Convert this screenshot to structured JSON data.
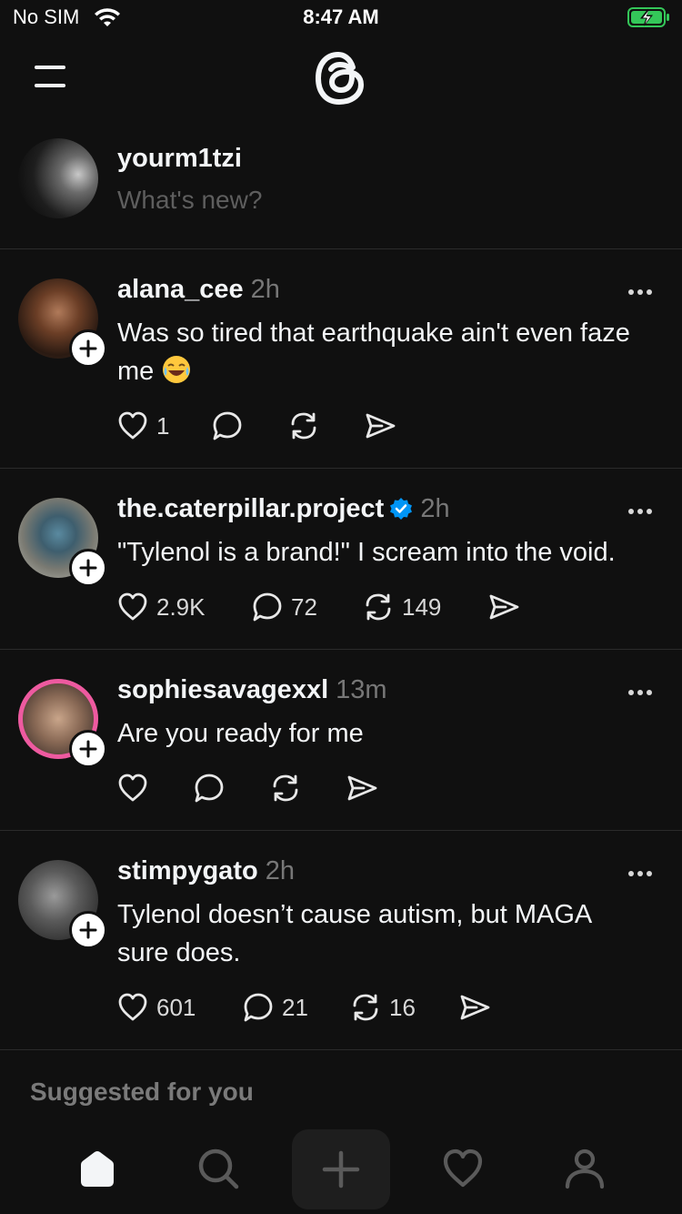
{
  "status_bar": {
    "carrier": "No SIM",
    "time": "8:47 AM",
    "wifi_icon": "wifi-icon",
    "battery_icon": "battery-charging-icon",
    "battery_color": "#34c759"
  },
  "header": {
    "menu_icon": "menu-icon",
    "logo_icon": "threads-logo-icon"
  },
  "composer": {
    "username": "yourm1tzi",
    "placeholder": "What's new?"
  },
  "posts": [
    {
      "username": "alana_cee",
      "time": "2h",
      "verified": false,
      "text": "Was so tired that earthquake ain't even faze me",
      "emoji": "laughing-crying-emoji",
      "likes": "1",
      "replies": "",
      "reposts": ""
    },
    {
      "username": "the.caterpillar.project",
      "time": "2h",
      "verified": true,
      "text": "\"Tylenol is a brand!\" I scream into the void.",
      "likes": "2.9K",
      "replies": "72",
      "reposts": "149"
    },
    {
      "username": "sophiesavagexxl",
      "time": "13m",
      "verified": false,
      "has_story_ring": true,
      "text": "Are you ready for me",
      "likes": "",
      "replies": "",
      "reposts": ""
    },
    {
      "username": "stimpygato",
      "time": "2h",
      "verified": false,
      "text": "Tylenol doesn’t cause autism, but MAGA sure does.",
      "likes": "601",
      "replies": "21",
      "reposts": "16"
    }
  ],
  "suggested": {
    "label": "Suggested for you"
  },
  "bottom_nav": {
    "items": [
      "home-icon",
      "search-icon",
      "create-icon",
      "activity-heart-icon",
      "profile-icon"
    ],
    "active": "home-icon"
  },
  "colors": {
    "background": "#101010",
    "text_primary": "#f3f5f7",
    "text_secondary": "#777777",
    "verified": "#0095f6",
    "story_ring": "#ee5aa0"
  }
}
